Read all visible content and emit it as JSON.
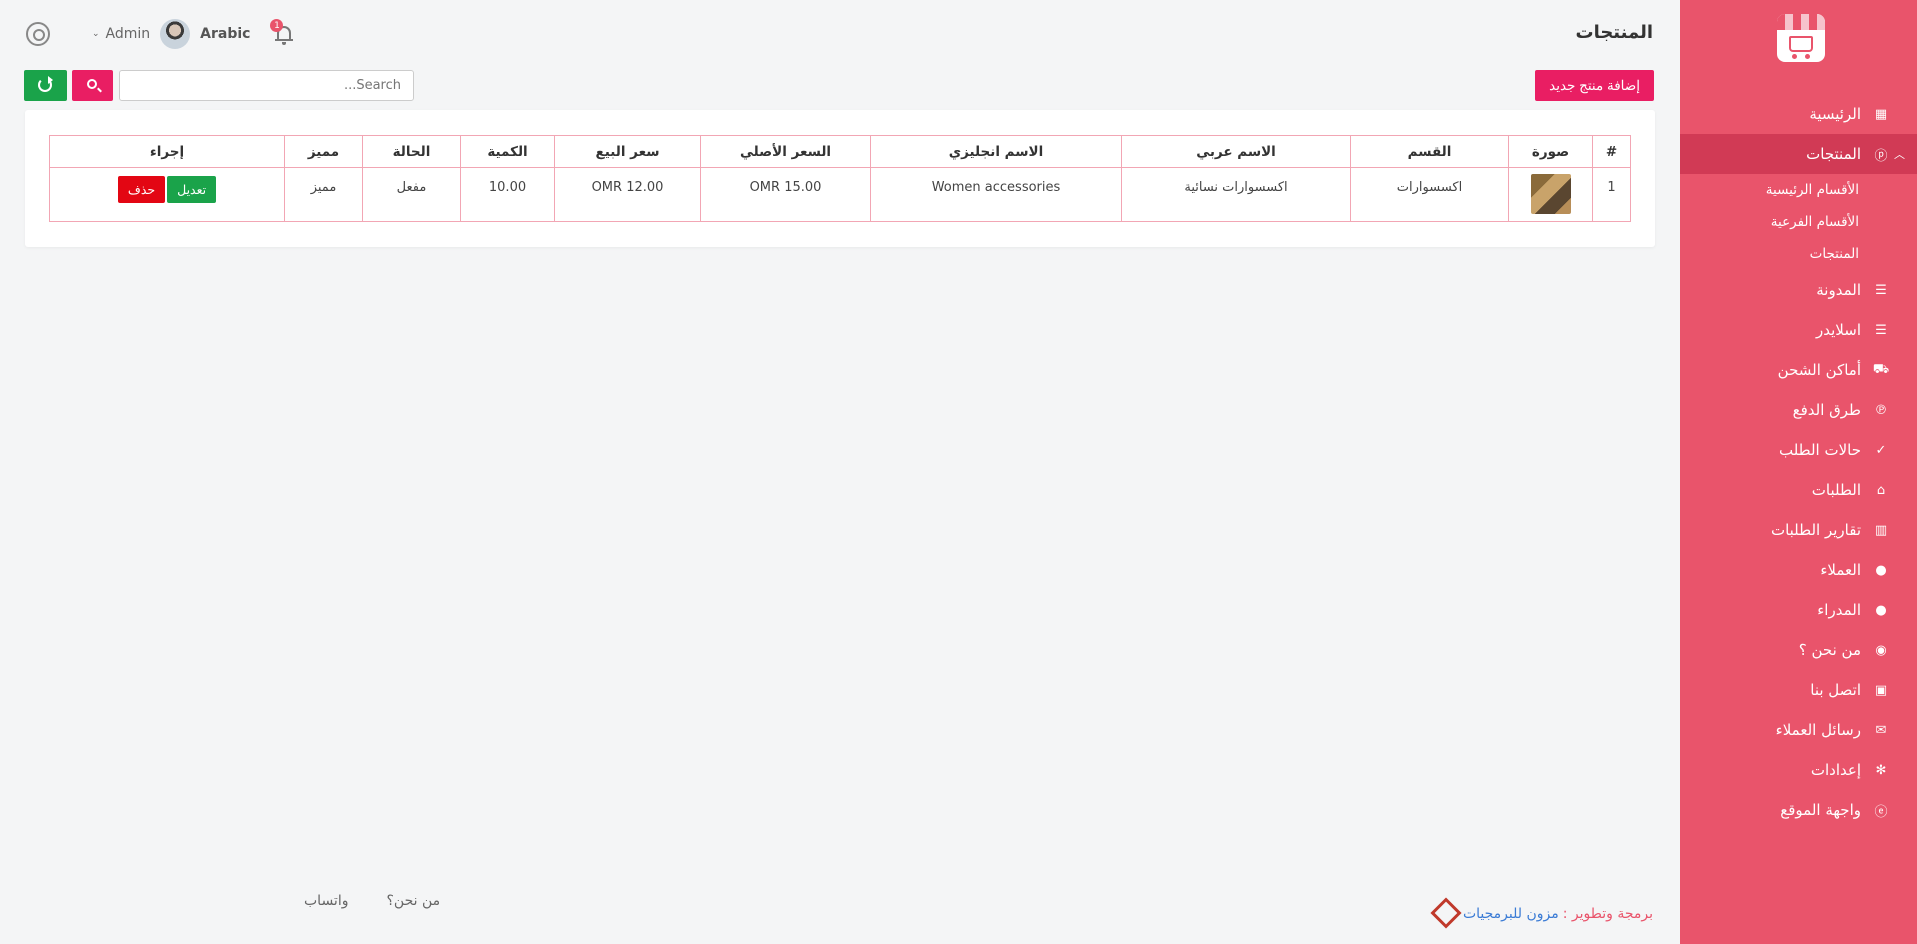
{
  "page": {
    "title": "المنتجات"
  },
  "header": {
    "language": "Arabic",
    "user": "Admin",
    "notification_count": "1"
  },
  "toolbar": {
    "add_label": "إضافة منتج جديد",
    "search_placeholder": "...Search"
  },
  "sidebar": {
    "items": [
      {
        "label": "الرئيسية",
        "icon": "dashboard-icon"
      },
      {
        "label": "المنتجات",
        "icon": "products-icon",
        "active": true
      },
      {
        "label": "المدونة",
        "icon": "sliders-icon"
      },
      {
        "label": "اسلايدر",
        "icon": "sliders-icon"
      },
      {
        "label": "أماكن الشحن",
        "icon": "truck-icon"
      },
      {
        "label": "طرق الدفع",
        "icon": "paypal-icon"
      },
      {
        "label": "حالات الطلب",
        "icon": "check-circle-icon"
      },
      {
        "label": "الطلبات",
        "icon": "basket-icon"
      },
      {
        "label": "تقارير الطلبات",
        "icon": "chart-icon"
      },
      {
        "label": "العملاء",
        "icon": "user-icon"
      },
      {
        "label": "المدراء",
        "icon": "user-icon"
      },
      {
        "label": "من نحن ؟",
        "icon": "eye-icon"
      },
      {
        "label": "اتصل بنا",
        "icon": "id-card-icon"
      },
      {
        "label": "رسائل العملاء",
        "icon": "envelope-icon"
      },
      {
        "label": "إعدادات",
        "icon": "gear-icon"
      },
      {
        "label": "واجهة الموقع",
        "icon": "browser-icon"
      }
    ],
    "subitems": [
      "الأقسام الرئيسية",
      "الأقسام الفرعية",
      "المنتجات"
    ]
  },
  "table": {
    "headers": [
      "#",
      "صورة",
      "القسم",
      "الاسم عربي",
      "الاسم انجليزي",
      "السعر الأصلي",
      "سعر البيع",
      "الكمية",
      "الحالة",
      "مميز",
      "إجراء"
    ],
    "rows": [
      {
        "index": "1",
        "category": "اكسسوارات",
        "name_ar": "اكسسوارات نسائية",
        "name_en": "Women accessories",
        "original_price": "OMR 15.00",
        "sale_price": "OMR 12.00",
        "quantity": "10.00",
        "status": "مفعل",
        "featured": "مميز",
        "edit_label": "تعديل",
        "delete_label": "حذف"
      }
    ]
  },
  "footer": {
    "dev_prefix": "برمجة وتطوير :",
    "dev_name": "مزون للبرمجيات",
    "links": [
      "من نحن؟",
      "واتساب"
    ]
  },
  "colors": {
    "sidebar": "#e9546b",
    "sidebar_active": "#d13a55",
    "primary": "#e91e63",
    "success": "#1aa34a",
    "danger": "#e30613"
  }
}
